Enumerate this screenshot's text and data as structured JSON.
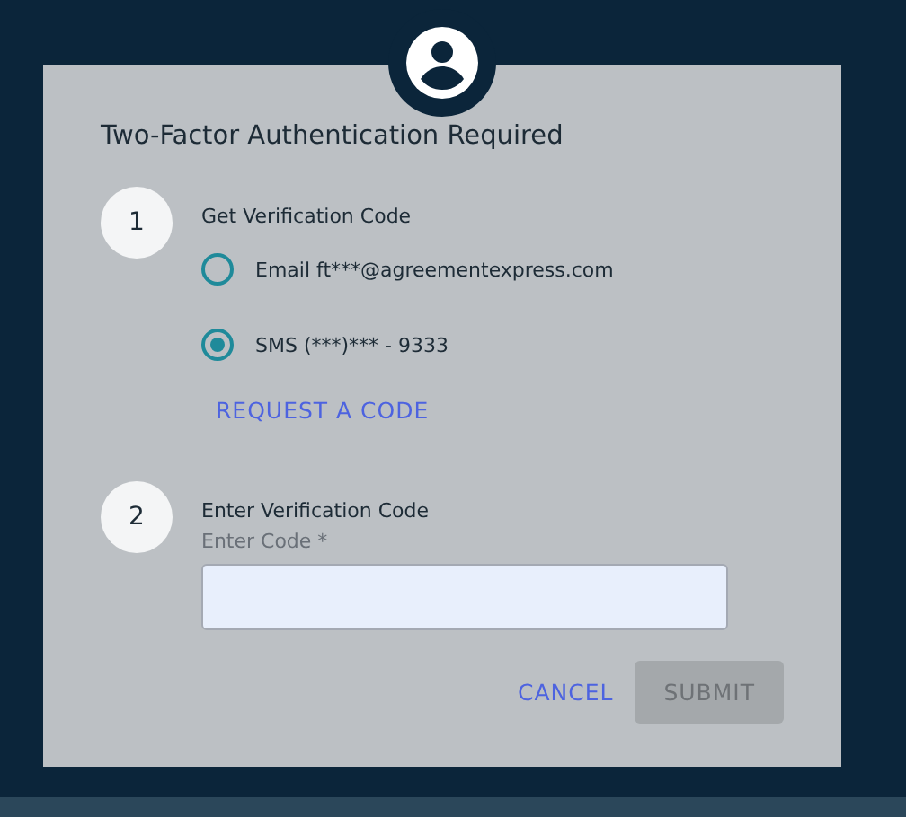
{
  "dialog": {
    "title": "Two-Factor Authentication Required",
    "steps": [
      {
        "number": "1",
        "label": "Get Verification Code",
        "options": [
          {
            "label": "Email ft***@agreementexpress.com",
            "selected": false
          },
          {
            "label": "SMS (***)*** - 9333",
            "selected": true
          }
        ],
        "link": "REQUEST A CODE"
      },
      {
        "number": "2",
        "label": "Enter Verification Code",
        "field": {
          "label": "Enter Code *"
        }
      }
    ],
    "buttons": [
      {
        "label": "CANCEL",
        "kind": "text",
        "disabled": false
      },
      {
        "label": "SUBMIT",
        "kind": "contained",
        "disabled": true
      }
    ]
  }
}
